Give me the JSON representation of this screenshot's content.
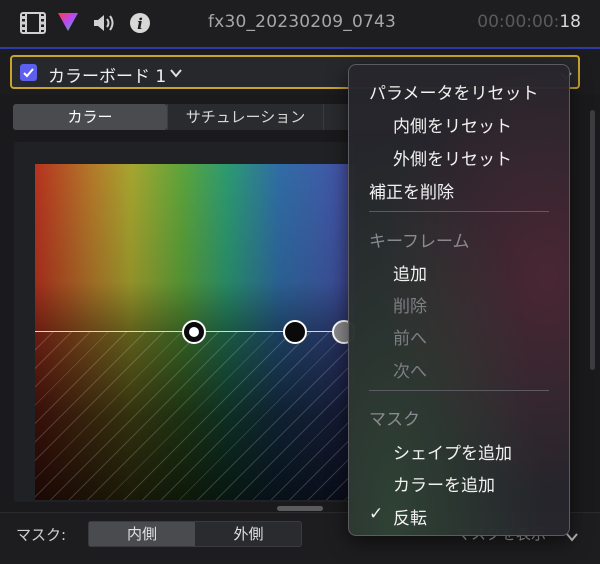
{
  "topbar": {
    "filename": "fx30_20230209_0743",
    "timecode_dim": "00:00:00:",
    "timecode_frames": "18",
    "icons": [
      "film-icon",
      "color-inspector-icon",
      "audio-icon",
      "info-icon"
    ]
  },
  "header": {
    "enabled": true,
    "effect_name": "カラーボード 1"
  },
  "tabs": [
    {
      "label": "カラー",
      "active": true
    },
    {
      "label": "サチュレーション",
      "active": false
    }
  ],
  "mask_row": {
    "label": "マスク:",
    "inside": "内側",
    "outside": "外側",
    "show_label": "マスクを表示"
  },
  "menu": {
    "reset_params": "パラメータをリセット",
    "reset_inside": "内側をリセット",
    "reset_outside": "外側をリセット",
    "delete_correction": "補正を削除",
    "keyframe_heading": "キーフレーム",
    "kf_add": "追加",
    "kf_delete": "削除",
    "kf_prev": "前へ",
    "kf_next": "次へ",
    "mask_heading": "マスク",
    "add_shape": "シェイプを追加",
    "add_color": "カラーを追加",
    "check": "✓",
    "invert": "反転"
  },
  "colors": {
    "accent": "#5d5ff0",
    "header_border": "#c9a32b",
    "timeline_line": "#2e3aa8"
  }
}
